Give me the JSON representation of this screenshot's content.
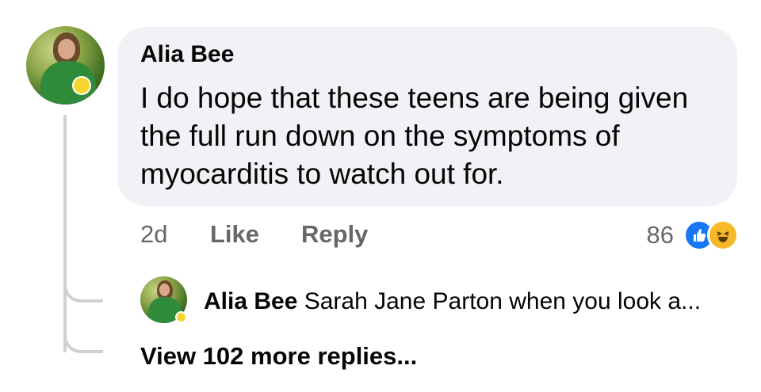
{
  "comment": {
    "author": "Alia Bee",
    "text": "I do hope that these teens are being given the full run down on the symptoms of myocarditis to watch out for.",
    "time": "2d",
    "like_label": "Like",
    "reply_label": "Reply",
    "reaction_count": "86",
    "reactions": [
      "like-icon",
      "haha-icon"
    ]
  },
  "reply": {
    "author": "Alia Bee",
    "preview": "Sarah Jane Parton when you look a..."
  },
  "view_more_label": "View 102 more replies...",
  "colors": {
    "bubble_bg": "#f0f2f5",
    "secondary_text": "#65676b",
    "like_blue": "#1877f2",
    "haha_yellow": "#f7b928",
    "thread_line": "#ced0d4"
  }
}
